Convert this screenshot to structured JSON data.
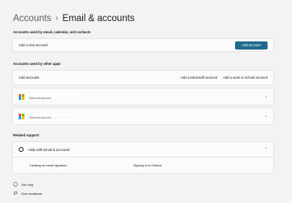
{
  "breadcrumb": {
    "parent": "Accounts",
    "separator": "›",
    "current": "Email & accounts"
  },
  "section_email": {
    "label": "Accounts used by email, calendar, and contacts"
  },
  "add_new": {
    "label": "Add a new account",
    "button": "Add account"
  },
  "section_other": {
    "label": "Accounts used by other apps"
  },
  "add_accounts": {
    "label": "Add accounts",
    "ms_button": "Add a Microsoft account",
    "work_button": "Add a work or school account"
  },
  "accounts": [
    {
      "type": "Microsoft account"
    },
    {
      "type": "Microsoft account"
    }
  ],
  "related": {
    "label": "Related support",
    "help_title": "Help with Email & accounts",
    "links": [
      "Creating an email signature",
      "Signing in to Outlook"
    ]
  },
  "footer": {
    "get_help": "Get help",
    "feedback": "Give feedback"
  },
  "colors": {
    "accent": "#1e6b8c",
    "ms_red": "#f25022",
    "ms_green": "#7fba00",
    "ms_blue": "#00a4ef",
    "ms_yellow": "#ffb900"
  }
}
